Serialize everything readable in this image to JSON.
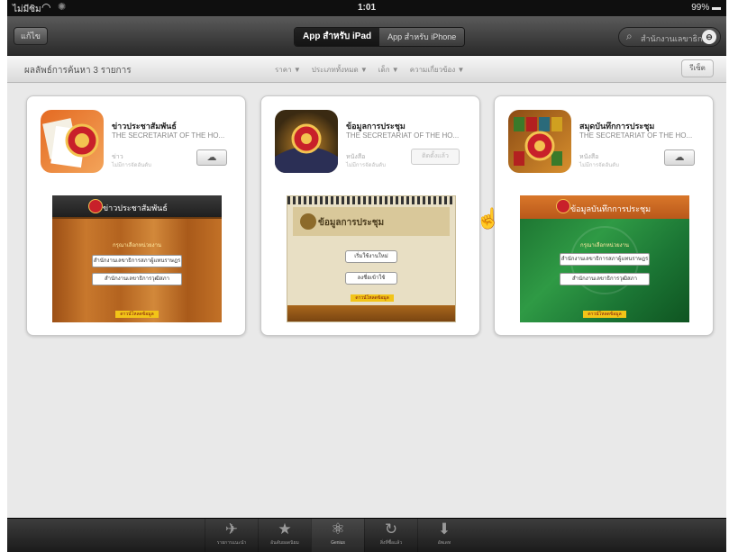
{
  "statusbar": {
    "carrier": "ไม่มีซิม",
    "time": "1:01",
    "battery": "99%"
  },
  "navbar": {
    "back_label": "แก้ไข",
    "segments": [
      {
        "label": "App สำหรับ iPad",
        "selected": true
      },
      {
        "label": "App สำหรับ iPhone",
        "selected": false
      }
    ],
    "search_text": "สำนักงานเลขาธิการ"
  },
  "filterbar": {
    "results_label": "ผลลัพธ์การค้นหา 3 รายการ",
    "filters": [
      "ราคา ▼",
      "ประเภททั้งหมด ▼",
      "เด็ก ▼",
      "ความเกี่ยวข้อง ▼"
    ],
    "sort_label": "รีเซ็ต"
  },
  "apps": [
    {
      "title": "ข่าวประชาสัมพันธ์",
      "developer": "THE SECRETARIAT OF THE HO...",
      "category": "ข่าว",
      "rating": "ไม่มีการจัดอันดับ",
      "action": "cloud",
      "action_icon": "☁",
      "icon_colors": [
        "#e46a22",
        "#f3a45a"
      ],
      "screenshot": {
        "title": "ข่าวประชาสัมพันธ์",
        "subtitle": "กรุณาเลือกหน่วยงาน",
        "buttons": [
          "สำนักงานเลขาธิการสภาผู้แทนราษฎร",
          "สำนักงานเลขาธิการวุฒิสภา"
        ],
        "footer": "ดาวน์โหลดข้อมูล"
      }
    },
    {
      "title": "ข้อมูลการประชุม",
      "developer": "THE SECRETARIAT OF THE HO...",
      "category": "หนังสือ",
      "rating": "ไม่มีการจัดอันดับ",
      "action": "installed",
      "action_label": "ติดตั้งแล้ว",
      "icon_colors": [
        "#3a2a12",
        "#c98a2a"
      ],
      "screenshot": {
        "title": "ข้อมูลการประชุม",
        "buttons": [
          "เริ่มใช้งานใหม่",
          "ลงชื่อเข้าใช้"
        ],
        "footer": "ดาวน์โหลดข้อมูล"
      }
    },
    {
      "title": "สมุดบันทึกการประชุม",
      "developer": "THE SECRETARIAT OF THE HO...",
      "category": "หนังสือ",
      "rating": "ไม่มีการจัดอันดับ",
      "action": "cloud",
      "action_icon": "☁",
      "icon_colors": [
        "#8a4a14",
        "#d8902e"
      ],
      "screenshot": {
        "title": "ข้อมูลบันทึกการประชุม",
        "subtitle": "กรุณาเลือกหน่วยงาน",
        "buttons": [
          "สำนักงานเลขาธิการสภาผู้แทนราษฎร",
          "สำนักงานเลขาธิการวุฒิสภา"
        ],
        "footer": "ดาวน์โหลดข้อมูล"
      }
    }
  ],
  "tabbar": {
    "tabs": [
      {
        "label": "รายการแนะนำ",
        "icon": "✈",
        "icon_name": "featured-icon"
      },
      {
        "label": "อันดับยอดนิยม",
        "icon": "★",
        "icon_name": "star-icon"
      },
      {
        "label": "Genius",
        "icon": "⚛",
        "icon_name": "genius-icon",
        "selected": true
      },
      {
        "label": "สิ่งที่ซื้อแล้ว",
        "icon": "↻",
        "icon_name": "purchased-icon"
      },
      {
        "label": "อัพเดท",
        "icon": "⬇",
        "icon_name": "updates-icon"
      }
    ]
  }
}
